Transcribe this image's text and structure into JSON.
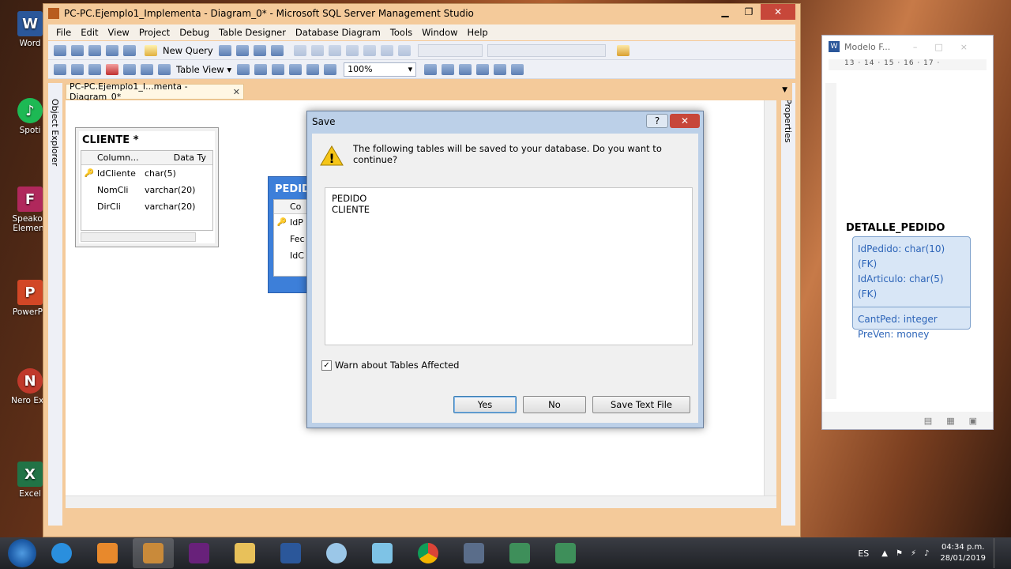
{
  "desktop": {
    "icons": [
      {
        "label": "Word",
        "color": "#2b579a",
        "glyph": "W"
      },
      {
        "label": "Spoti",
        "color": "#1db954",
        "glyph": "♪"
      },
      {
        "label": "Speakou\nElement",
        "color": "#d24726",
        "glyph": "F"
      },
      {
        "label": "PowerPo",
        "color": "#d24726",
        "glyph": "P"
      },
      {
        "label": "Nero Exp",
        "color": "#c0392b",
        "glyph": "N"
      },
      {
        "label": "Excel",
        "color": "#217346",
        "glyph": "X"
      }
    ]
  },
  "ssms": {
    "title": "PC-PC.Ejemplo1_Implementa - Diagram_0* - Microsoft SQL Server Management Studio",
    "menu": [
      "File",
      "Edit",
      "View",
      "Project",
      "Debug",
      "Table Designer",
      "Database Diagram",
      "Tools",
      "Window",
      "Help"
    ],
    "toolbar": {
      "new_query": "New Query",
      "table_view": "Table View",
      "zoom": "100%"
    },
    "sidebar_left": "Object Explorer",
    "sidebar_right": "Properties",
    "doc_tab": "PC-PC.Ejemplo1_I...menta - Diagram_0*",
    "cliente_table": {
      "title": "CLIENTE *",
      "headers": [
        "Column...",
        "Data Ty"
      ],
      "rows": [
        {
          "key": true,
          "name": "IdCliente",
          "type": "char(5)"
        },
        {
          "key": false,
          "name": "NomCli",
          "type": "varchar(20)"
        },
        {
          "key": false,
          "name": "DirCli",
          "type": "varchar(20)"
        }
      ]
    },
    "pedido_table": {
      "title": "PEDID",
      "header": "Co",
      "rows": [
        {
          "key": true,
          "name": "IdP"
        },
        {
          "key": false,
          "name": "Fec"
        },
        {
          "key": false,
          "name": "IdC"
        }
      ]
    }
  },
  "dialog": {
    "title": "Save",
    "help": "?",
    "message": "The following tables will be saved to your database. Do you want to continue?",
    "tables": [
      "PEDIDO",
      "CLIENTE"
    ],
    "warn_label": "Warn about Tables Affected",
    "warn_checked": true,
    "buttons": {
      "yes": "Yes",
      "no": "No",
      "save_text": "Save Text File"
    }
  },
  "word": {
    "title": "Modelo F...",
    "ruler": "13 · 14 · 15 · 16 · 17 ·",
    "entity": {
      "name": "DETALLE_PEDIDO",
      "keys": [
        "IdPedido: char(10) (FK)",
        "IdArticulo: char(5) (FK)"
      ],
      "attrs": [
        "CantPed: integer",
        "PreVen: money"
      ]
    }
  },
  "taskbar": {
    "lang": "ES",
    "time": "04:34 p.m.",
    "date": "28/01/2019"
  }
}
